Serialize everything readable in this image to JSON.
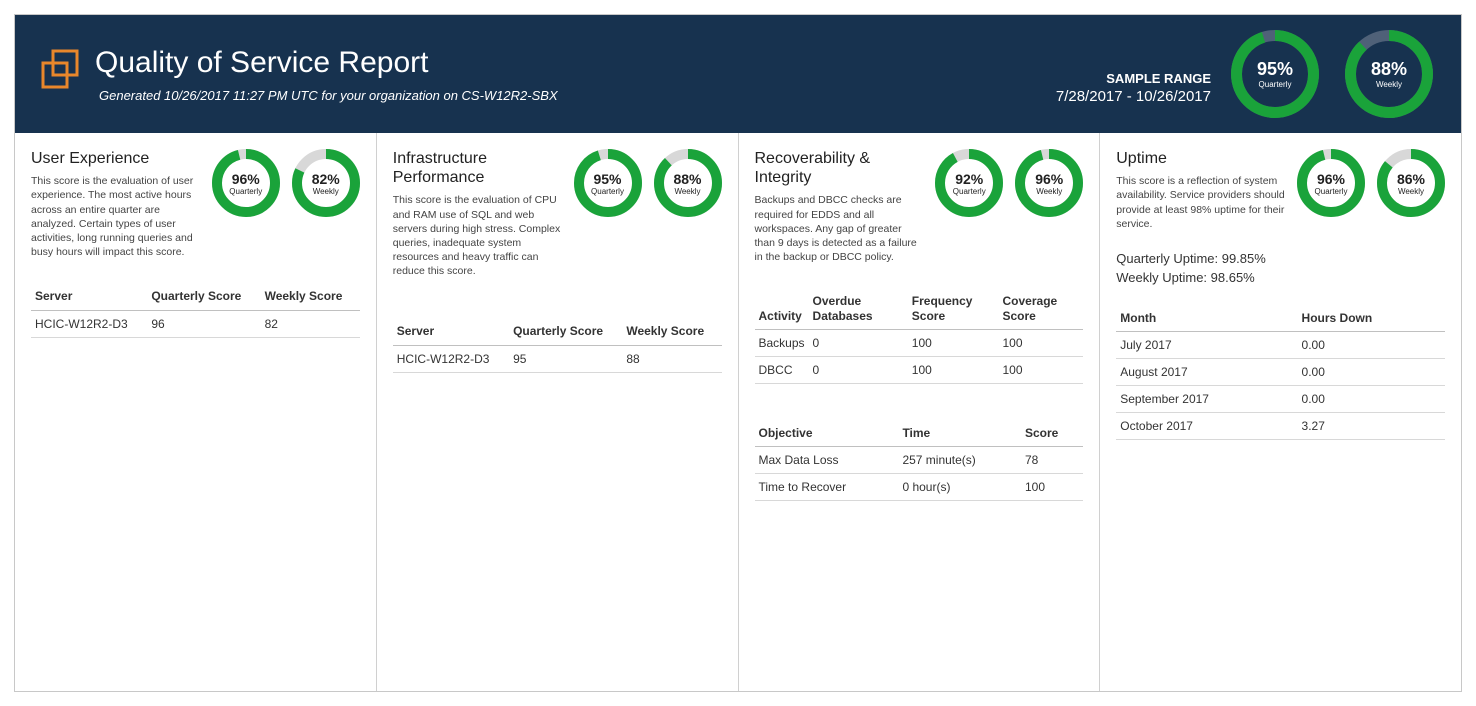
{
  "header": {
    "title": "Quality of Service Report",
    "subtitle": "Generated 10/26/2017 11:27 PM UTC for your organization on CS-W12R2-SBX",
    "range_label": "SAMPLE RANGE",
    "range_value": "7/28/2017 - 10/26/2017",
    "quarterly_pct": 95,
    "weekly_pct": 88
  },
  "labels": {
    "quarterly": "Quarterly",
    "weekly": "Weekly"
  },
  "panels": {
    "ux": {
      "title": "User Experience",
      "desc": "This score is the evaluation of user experience. The most active hours across an entire quarter are analyzed. Certain types of user activities, long running queries and busy hours will impact this score.",
      "quarterly_pct": 96,
      "weekly_pct": 82,
      "table": {
        "cols": [
          "Server",
          "Quarterly Score",
          "Weekly Score"
        ],
        "rows": [
          [
            "HCIC-W12R2-D3",
            "96",
            "82"
          ]
        ]
      }
    },
    "infra": {
      "title": "Infrastructure Performance",
      "desc": "This score is the evaluation of CPU and RAM use of SQL and web servers during high stress. Complex queries, inadequate system resources and heavy traffic can reduce this score.",
      "quarterly_pct": 95,
      "weekly_pct": 88,
      "table": {
        "cols": [
          "Server",
          "Quarterly Score",
          "Weekly Score"
        ],
        "rows": [
          [
            "HCIC-W12R2-D3",
            "95",
            "88"
          ]
        ]
      }
    },
    "recov": {
      "title": "Recoverability & Integrity",
      "desc": "Backups and DBCC checks are required for EDDS and all workspaces. Any gap of greater than 9 days is detected as a failure in the backup or DBCC policy.",
      "quarterly_pct": 92,
      "weekly_pct": 96,
      "table1": {
        "cols": [
          "Activity",
          "Overdue Databases",
          "Frequency Score",
          "Coverage Score"
        ],
        "rows": [
          [
            "Backups",
            "0",
            "100",
            "100"
          ],
          [
            "DBCC",
            "0",
            "100",
            "100"
          ]
        ]
      },
      "table2": {
        "cols": [
          "Objective",
          "Time",
          "Score"
        ],
        "rows": [
          [
            "Max Data Loss",
            "257 minute(s)",
            "78"
          ],
          [
            "Time to Recover",
            "0 hour(s)",
            "100"
          ]
        ]
      }
    },
    "uptime": {
      "title": "Uptime",
      "desc": "This score is a reflection of system availability. Service providers should provide at least 98% uptime for their service.",
      "quarterly_pct": 96,
      "weekly_pct": 86,
      "quarterly_uptime": "Quarterly Uptime: 99.85%",
      "weekly_uptime": "Weekly Uptime: 98.65%",
      "table": {
        "cols": [
          "Month",
          "Hours Down"
        ],
        "rows": [
          [
            "July 2017",
            "0.00"
          ],
          [
            "August 2017",
            "0.00"
          ],
          [
            "September 2017",
            "0.00"
          ],
          [
            "October 2017",
            "3.27"
          ]
        ]
      }
    }
  },
  "chart_data": [
    {
      "type": "pie",
      "title": "Overall Quarterly",
      "values": [
        95,
        5
      ],
      "categories": [
        "Score",
        "Remaining"
      ],
      "display": "95%"
    },
    {
      "type": "pie",
      "title": "Overall Weekly",
      "values": [
        88,
        12
      ],
      "categories": [
        "Score",
        "Remaining"
      ],
      "display": "88%"
    },
    {
      "type": "pie",
      "title": "User Experience Quarterly",
      "values": [
        96,
        4
      ],
      "categories": [
        "Score",
        "Remaining"
      ],
      "display": "96%"
    },
    {
      "type": "pie",
      "title": "User Experience Weekly",
      "values": [
        82,
        18
      ],
      "categories": [
        "Score",
        "Remaining"
      ],
      "display": "82%"
    },
    {
      "type": "pie",
      "title": "Infrastructure Quarterly",
      "values": [
        95,
        5
      ],
      "categories": [
        "Score",
        "Remaining"
      ],
      "display": "95%"
    },
    {
      "type": "pie",
      "title": "Infrastructure Weekly",
      "values": [
        88,
        12
      ],
      "categories": [
        "Score",
        "Remaining"
      ],
      "display": "88%"
    },
    {
      "type": "pie",
      "title": "Recoverability Quarterly",
      "values": [
        92,
        8
      ],
      "categories": [
        "Score",
        "Remaining"
      ],
      "display": "92%"
    },
    {
      "type": "pie",
      "title": "Recoverability Weekly",
      "values": [
        96,
        4
      ],
      "categories": [
        "Score",
        "Remaining"
      ],
      "display": "96%"
    },
    {
      "type": "pie",
      "title": "Uptime Quarterly",
      "values": [
        96,
        4
      ],
      "categories": [
        "Score",
        "Remaining"
      ],
      "display": "96%"
    },
    {
      "type": "pie",
      "title": "Uptime Weekly",
      "values": [
        86,
        14
      ],
      "categories": [
        "Score",
        "Remaining"
      ],
      "display": "86%"
    }
  ]
}
